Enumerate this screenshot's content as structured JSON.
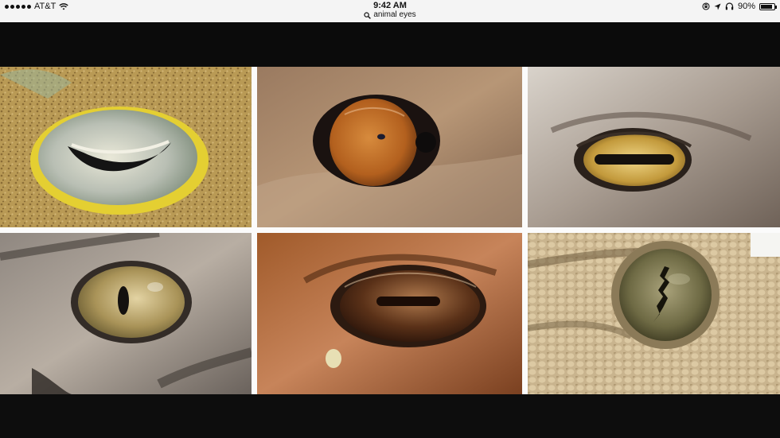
{
  "status_bar": {
    "carrier": "AT&T",
    "time": "9:42 AM",
    "search_query": "animal eyes",
    "battery_percent": "90%",
    "battery_level": 0.9
  },
  "icons": [
    "signal-dots-icon",
    "wifi-icon",
    "search-icon",
    "screen-lock-icon",
    "location-arrow-icon",
    "headphones-icon",
    "battery-icon"
  ],
  "photos": [
    {
      "subject": "cuttlefish-eye"
    },
    {
      "subject": "lion-eye"
    },
    {
      "subject": "goat-eye"
    },
    {
      "subject": "cat-eye"
    },
    {
      "subject": "horse-eye"
    },
    {
      "subject": "gecko-eye"
    }
  ]
}
